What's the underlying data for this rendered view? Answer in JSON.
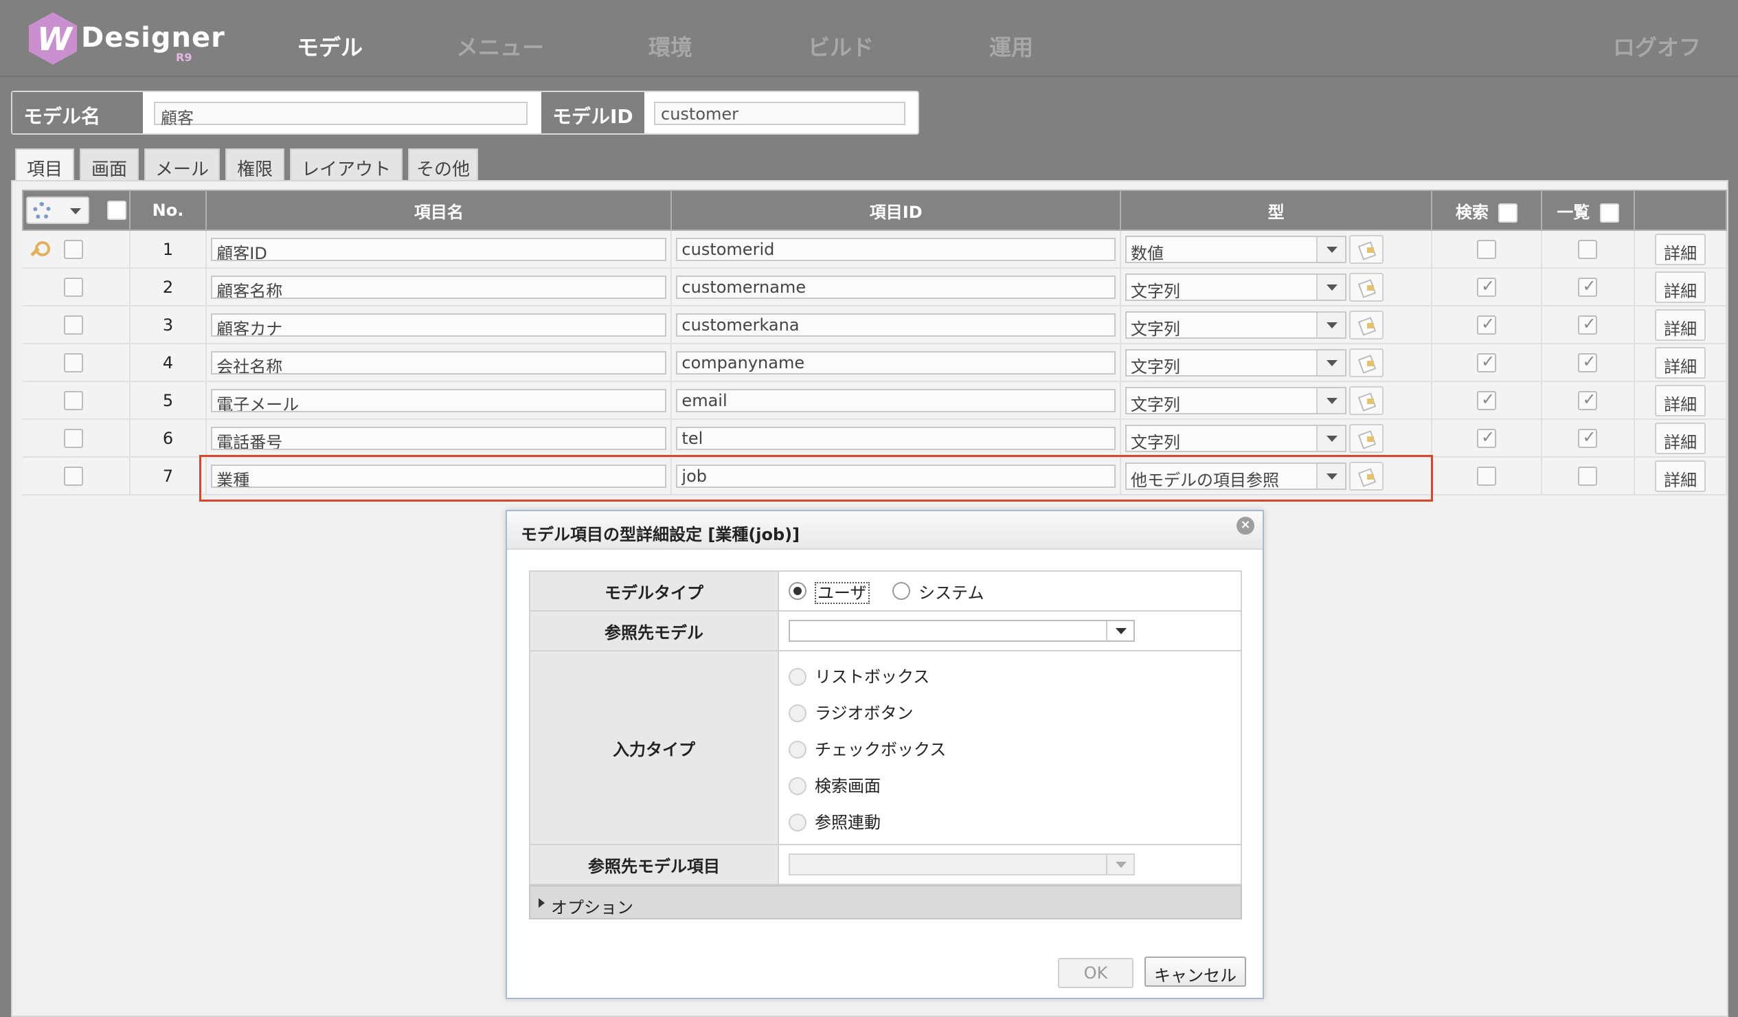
{
  "app": {
    "logo_text": "Designer",
    "logo_version": "R9",
    "logo_mark": "W"
  },
  "nav": {
    "items": [
      "モデル",
      "メニュー",
      "環境",
      "ビルド",
      "運用"
    ],
    "logout": "ログオフ"
  },
  "model": {
    "name_label": "モデル名",
    "name_value": "顧客",
    "id_label": "モデルID",
    "id_value": "customer"
  },
  "tabs": [
    "項目",
    "画面",
    "メール",
    "権限",
    "レイアウト",
    "その他"
  ],
  "grid": {
    "headers": {
      "no": "No.",
      "item_name": "項目名",
      "item_id": "項目ID",
      "type": "型",
      "search": "検索",
      "list": "一覧"
    },
    "detail_label": "詳細",
    "rows": [
      {
        "no": "1",
        "name": "顧客ID",
        "id": "customerid",
        "type": "数値",
        "search": false,
        "list": false,
        "key": true
      },
      {
        "no": "2",
        "name": "顧客名称",
        "id": "customername",
        "type": "文字列",
        "search": true,
        "list": true,
        "key": false
      },
      {
        "no": "3",
        "name": "顧客カナ",
        "id": "customerkana",
        "type": "文字列",
        "search": true,
        "list": true,
        "key": false
      },
      {
        "no": "4",
        "name": "会社名称",
        "id": "companyname",
        "type": "文字列",
        "search": true,
        "list": true,
        "key": false
      },
      {
        "no": "5",
        "name": "電子メール",
        "id": "email",
        "type": "文字列",
        "search": true,
        "list": true,
        "key": false
      },
      {
        "no": "6",
        "name": "電話番号",
        "id": "tel",
        "type": "文字列",
        "search": true,
        "list": true,
        "key": false
      },
      {
        "no": "7",
        "name": "業種",
        "id": "job",
        "type": "他モデルの項目参照",
        "search": false,
        "list": false,
        "key": false
      }
    ]
  },
  "dialog": {
    "title": "モデル項目の型詳細設定 [業種(job)]",
    "model_type_label": "モデルタイプ",
    "model_type_options": [
      "ユーザ",
      "システム"
    ],
    "ref_model_label": "参照先モデル",
    "ref_model_value": "",
    "input_type_label": "入力タイプ",
    "input_type_options": [
      "リストボックス",
      "ラジオボタン",
      "チェックボックス",
      "検索画面",
      "参照連動"
    ],
    "ref_item_label": "参照先モデル項目",
    "ref_item_value": "",
    "options_label": "オプション",
    "ok_label": "OK",
    "cancel_label": "キャンセル"
  }
}
